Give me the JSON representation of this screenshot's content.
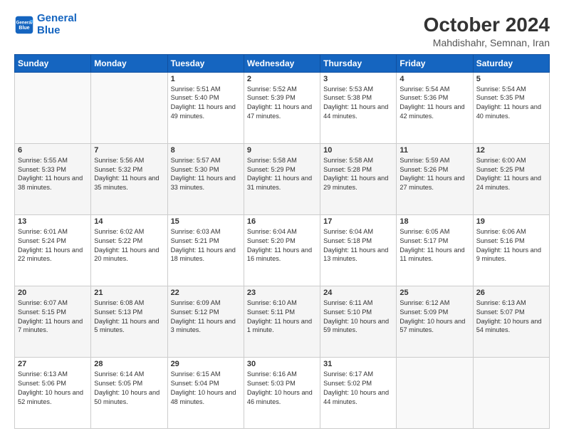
{
  "header": {
    "logo_line1": "General",
    "logo_line2": "Blue",
    "main_title": "October 2024",
    "sub_title": "Mahdishahr, Semnan, Iran"
  },
  "weekdays": [
    "Sunday",
    "Monday",
    "Tuesday",
    "Wednesday",
    "Thursday",
    "Friday",
    "Saturday"
  ],
  "weeks": [
    [
      {
        "day": "",
        "detail": ""
      },
      {
        "day": "",
        "detail": ""
      },
      {
        "day": "1",
        "detail": "Sunrise: 5:51 AM\nSunset: 5:40 PM\nDaylight: 11 hours and 49 minutes."
      },
      {
        "day": "2",
        "detail": "Sunrise: 5:52 AM\nSunset: 5:39 PM\nDaylight: 11 hours and 47 minutes."
      },
      {
        "day": "3",
        "detail": "Sunrise: 5:53 AM\nSunset: 5:38 PM\nDaylight: 11 hours and 44 minutes."
      },
      {
        "day": "4",
        "detail": "Sunrise: 5:54 AM\nSunset: 5:36 PM\nDaylight: 11 hours and 42 minutes."
      },
      {
        "day": "5",
        "detail": "Sunrise: 5:54 AM\nSunset: 5:35 PM\nDaylight: 11 hours and 40 minutes."
      }
    ],
    [
      {
        "day": "6",
        "detail": "Sunrise: 5:55 AM\nSunset: 5:33 PM\nDaylight: 11 hours and 38 minutes."
      },
      {
        "day": "7",
        "detail": "Sunrise: 5:56 AM\nSunset: 5:32 PM\nDaylight: 11 hours and 35 minutes."
      },
      {
        "day": "8",
        "detail": "Sunrise: 5:57 AM\nSunset: 5:30 PM\nDaylight: 11 hours and 33 minutes."
      },
      {
        "day": "9",
        "detail": "Sunrise: 5:58 AM\nSunset: 5:29 PM\nDaylight: 11 hours and 31 minutes."
      },
      {
        "day": "10",
        "detail": "Sunrise: 5:58 AM\nSunset: 5:28 PM\nDaylight: 11 hours and 29 minutes."
      },
      {
        "day": "11",
        "detail": "Sunrise: 5:59 AM\nSunset: 5:26 PM\nDaylight: 11 hours and 27 minutes."
      },
      {
        "day": "12",
        "detail": "Sunrise: 6:00 AM\nSunset: 5:25 PM\nDaylight: 11 hours and 24 minutes."
      }
    ],
    [
      {
        "day": "13",
        "detail": "Sunrise: 6:01 AM\nSunset: 5:24 PM\nDaylight: 11 hours and 22 minutes."
      },
      {
        "day": "14",
        "detail": "Sunrise: 6:02 AM\nSunset: 5:22 PM\nDaylight: 11 hours and 20 minutes."
      },
      {
        "day": "15",
        "detail": "Sunrise: 6:03 AM\nSunset: 5:21 PM\nDaylight: 11 hours and 18 minutes."
      },
      {
        "day": "16",
        "detail": "Sunrise: 6:04 AM\nSunset: 5:20 PM\nDaylight: 11 hours and 16 minutes."
      },
      {
        "day": "17",
        "detail": "Sunrise: 6:04 AM\nSunset: 5:18 PM\nDaylight: 11 hours and 13 minutes."
      },
      {
        "day": "18",
        "detail": "Sunrise: 6:05 AM\nSunset: 5:17 PM\nDaylight: 11 hours and 11 minutes."
      },
      {
        "day": "19",
        "detail": "Sunrise: 6:06 AM\nSunset: 5:16 PM\nDaylight: 11 hours and 9 minutes."
      }
    ],
    [
      {
        "day": "20",
        "detail": "Sunrise: 6:07 AM\nSunset: 5:15 PM\nDaylight: 11 hours and 7 minutes."
      },
      {
        "day": "21",
        "detail": "Sunrise: 6:08 AM\nSunset: 5:13 PM\nDaylight: 11 hours and 5 minutes."
      },
      {
        "day": "22",
        "detail": "Sunrise: 6:09 AM\nSunset: 5:12 PM\nDaylight: 11 hours and 3 minutes."
      },
      {
        "day": "23",
        "detail": "Sunrise: 6:10 AM\nSunset: 5:11 PM\nDaylight: 11 hours and 1 minute."
      },
      {
        "day": "24",
        "detail": "Sunrise: 6:11 AM\nSunset: 5:10 PM\nDaylight: 10 hours and 59 minutes."
      },
      {
        "day": "25",
        "detail": "Sunrise: 6:12 AM\nSunset: 5:09 PM\nDaylight: 10 hours and 57 minutes."
      },
      {
        "day": "26",
        "detail": "Sunrise: 6:13 AM\nSunset: 5:07 PM\nDaylight: 10 hours and 54 minutes."
      }
    ],
    [
      {
        "day": "27",
        "detail": "Sunrise: 6:13 AM\nSunset: 5:06 PM\nDaylight: 10 hours and 52 minutes."
      },
      {
        "day": "28",
        "detail": "Sunrise: 6:14 AM\nSunset: 5:05 PM\nDaylight: 10 hours and 50 minutes."
      },
      {
        "day": "29",
        "detail": "Sunrise: 6:15 AM\nSunset: 5:04 PM\nDaylight: 10 hours and 48 minutes."
      },
      {
        "day": "30",
        "detail": "Sunrise: 6:16 AM\nSunset: 5:03 PM\nDaylight: 10 hours and 46 minutes."
      },
      {
        "day": "31",
        "detail": "Sunrise: 6:17 AM\nSunset: 5:02 PM\nDaylight: 10 hours and 44 minutes."
      },
      {
        "day": "",
        "detail": ""
      },
      {
        "day": "",
        "detail": ""
      }
    ]
  ]
}
